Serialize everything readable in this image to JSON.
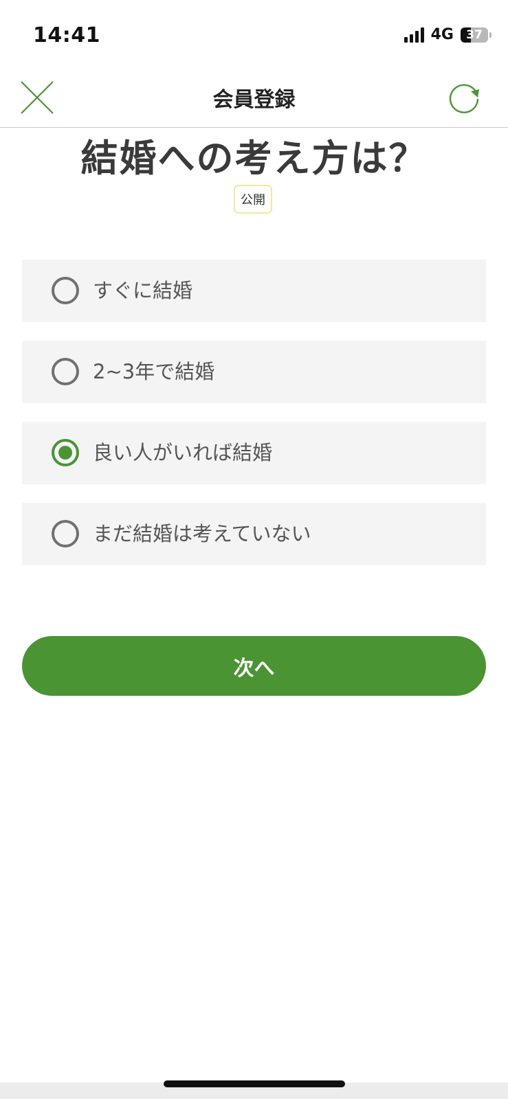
{
  "status_bar": {
    "time": "14:41",
    "network": "4G",
    "battery_level": "37",
    "signal_icon": "signal-bars-icon",
    "battery_icon": "battery-icon"
  },
  "nav": {
    "title": "会員登録",
    "close_icon": "close-icon",
    "refresh_icon": "refresh-icon",
    "accent_color": "#4a9434"
  },
  "question": {
    "title": "結婚への考え方は？",
    "visibility_badge": "公開"
  },
  "options": [
    {
      "label": "すぐに結婚",
      "selected": false
    },
    {
      "label": "2~3年で結婚",
      "selected": false
    },
    {
      "label": "良い人がいれば結婚",
      "selected": true
    },
    {
      "label": "まだ結婚は考えていない",
      "selected": false
    }
  ],
  "next_button": {
    "label": "次へ",
    "color": "#4a9434"
  }
}
